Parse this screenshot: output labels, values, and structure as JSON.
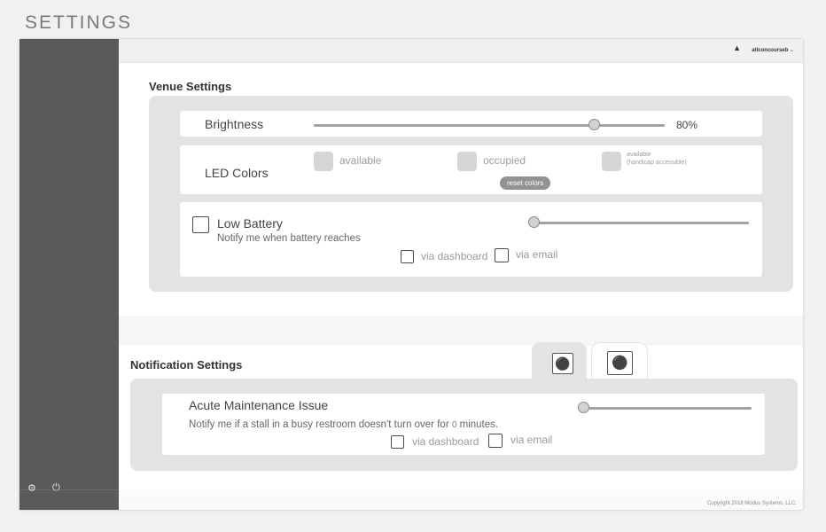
{
  "page": {
    "title": "SETTINGS"
  },
  "topbar": {
    "username": "atlconcourseb",
    "chevron": "⌄",
    "warning_icon": "warning-icon"
  },
  "sidebar": {
    "icons": [
      "gear-icon",
      "power-icon"
    ]
  },
  "venue": {
    "title": "Venue Settings",
    "brightness": {
      "label": "Brightness",
      "value_label": "80%",
      "value": 0.8
    },
    "led": {
      "label": "LED Colors",
      "swatches": [
        "available",
        "occupied"
      ],
      "handicap_line1": "available",
      "handicap_line2": "(handicap accessible)",
      "reset_label": "reset colors",
      "swatch_color": "#d5d5d5"
    },
    "battery": {
      "label": "Low Battery",
      "sub": "Notify me when battery reaches",
      "slider_value": 0.0,
      "via_dashboard": "via dashboard",
      "via_email": "via email"
    }
  },
  "notifications": {
    "title": "Notification Settings",
    "tabs": [
      "female-restroom-icon",
      "male-restroom-icon"
    ],
    "maintenance": {
      "label": "Acute Maintenance Issue",
      "sub_before": "Notify me if a stall in a busy restroom doesn't turn over for",
      "minutes_value": "0",
      "sub_after": "minutes.",
      "slider_value": 0.0,
      "via_dashboard": "via dashboard",
      "via_email": "via email"
    }
  },
  "footer": {
    "copyright": "Copyright 2018 Modus Systems, LLC."
  },
  "colors": {
    "sidebar": "#5a5a5a",
    "panel": "#e3e3e3",
    "background": "#f1f1f1",
    "pill": "#929292"
  }
}
